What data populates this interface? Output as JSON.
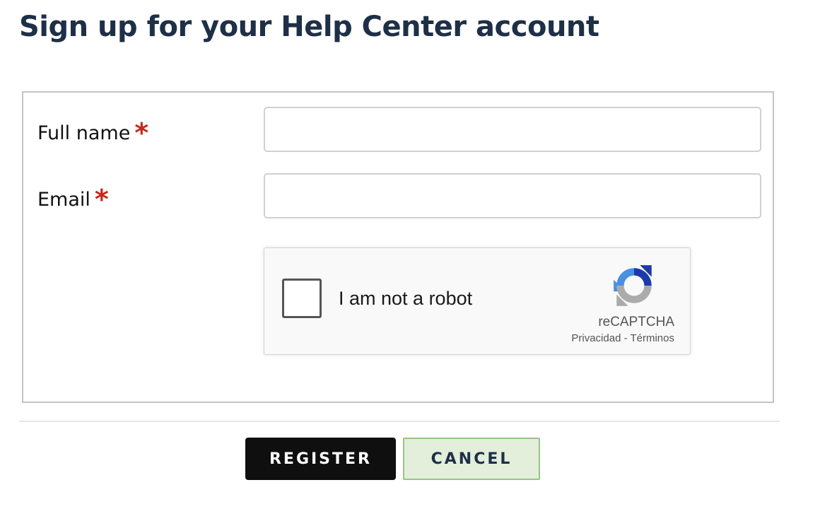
{
  "page": {
    "title": "Sign up for your Help Center account"
  },
  "form": {
    "full_name": {
      "label": "Full name",
      "required_mark": "*",
      "value": ""
    },
    "email": {
      "label": "Email",
      "required_mark": "*",
      "value": ""
    }
  },
  "captcha": {
    "checkbox_label": "I am not a robot",
    "brand": "reCAPTCHA",
    "privacy_link": "Privacidad",
    "separator": " - ",
    "terms_link": "Términos",
    "checked": false,
    "logo_icon": "recaptcha-logo-icon"
  },
  "actions": {
    "register_label": "REGISTER",
    "cancel_label": "CANCEL"
  },
  "colors": {
    "title": "#1d3047",
    "required": "#c7261c",
    "register_bg": "#0f0f0f",
    "cancel_bg": "#e3eedb",
    "cancel_border": "#98c487"
  }
}
